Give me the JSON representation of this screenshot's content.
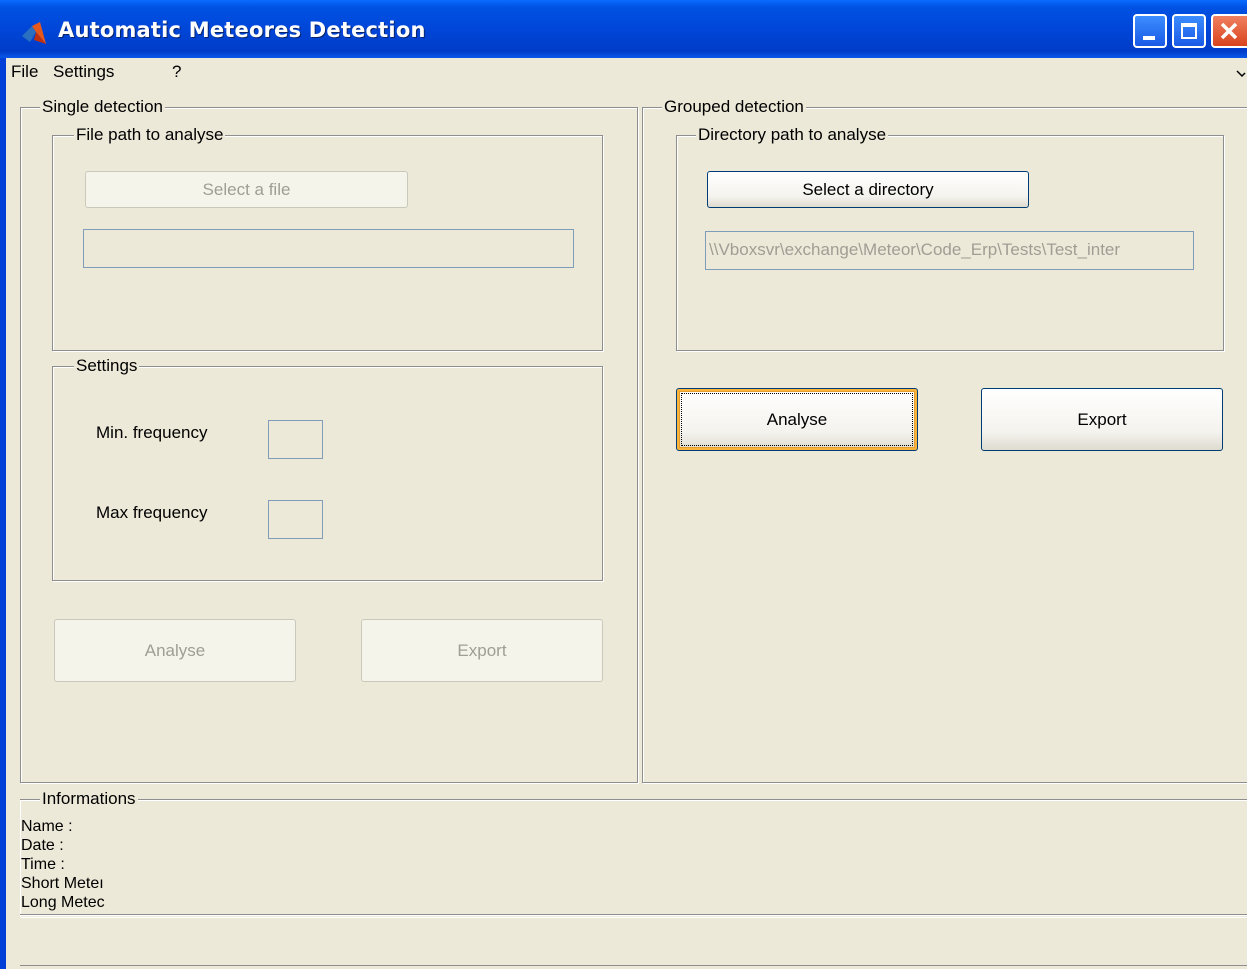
{
  "window": {
    "title": "Automatic Meteores Detection"
  },
  "menu": {
    "items": [
      "File",
      "Settings",
      "?"
    ]
  },
  "single_detection": {
    "title": "Single detection",
    "file_path": {
      "title": "File path to analyse",
      "select_label": "Select a file",
      "path_value": ""
    },
    "settings": {
      "title": "Settings",
      "min_label": "Min. frequency",
      "min_value": "",
      "max_label": "Max frequency",
      "max_value": ""
    },
    "analyse_label": "Analyse",
    "export_label": "Export"
  },
  "grouped_detection": {
    "title": "Grouped detection",
    "directory_path": {
      "title": "Directory path to analyse",
      "select_label": "Select a directory",
      "path_value": "\\\\Vboxsvr\\exchange\\Meteor\\Code_Erp\\Tests\\Test_inter"
    },
    "analyse_label": "Analyse",
    "export_label": "Export"
  },
  "informations": {
    "title": "Informations",
    "lines": [
      "Name :",
      "Date :",
      "Time :",
      "Short Meteı",
      "Long Metec"
    ]
  },
  "colors": {
    "titlebar": "#0046d8",
    "window_bg": "#ece9d8",
    "focus_ring": "#f8b43c"
  }
}
